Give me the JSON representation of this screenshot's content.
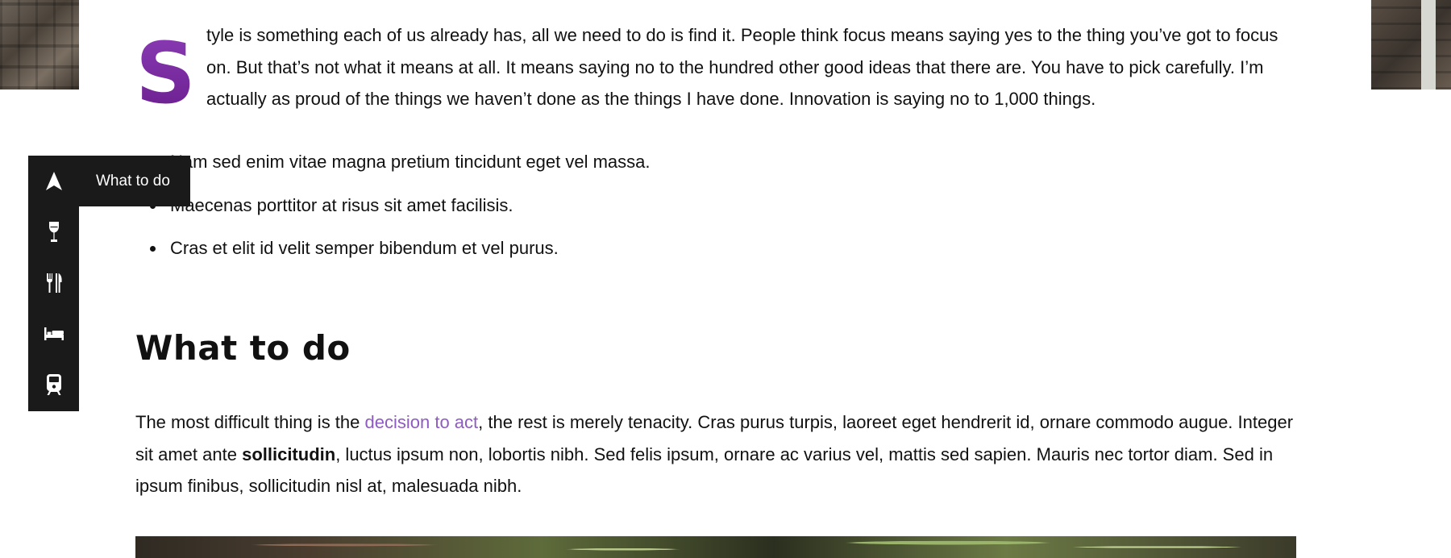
{
  "intro": {
    "drop_cap": "S",
    "text": "tyle is something each of us already has, all we need to do is find it. People think focus means saying yes to the thing you’ve got to focus on. But that’s not what it means at all. It means saying no to the hundred other good ideas that there are. You have to pick carefully. I’m actually as proud of the things we haven’t done as the things I have done. Innovation is saying no to 1,000 things."
  },
  "bullets": [
    "Nam sed enim vitae magna pretium tincidunt eget vel massa.",
    "Maecenas porttitor at risus sit amet facilisis.",
    "Cras et elit id velit semper bibendum et vel purus."
  ],
  "section": {
    "heading": "What to do",
    "para_before_link": "The most difficult thing is the ",
    "link_text": "decision to act",
    "para_after_link": ", the rest is merely tenacity. Cras purus turpis, laoreet eget hendrerit id, ornare commodo augue. Integer sit amet ante ",
    "bold_text": "sollicitudin",
    "para_end": ", luctus ipsum non, lobortis nibh. Sed felis ipsum, ornare ac varius vel, mattis sed sapien. Mauris nec tortor diam. Sed in ipsum finibus, sollicitudin nisl at, malesuada nibh."
  },
  "sidenav": {
    "tooltip": "What to do",
    "items": [
      {
        "icon": "navigation-arrow-icon"
      },
      {
        "icon": "wine-glass-icon"
      },
      {
        "icon": "fork-knife-icon"
      },
      {
        "icon": "bed-icon"
      },
      {
        "icon": "train-icon"
      }
    ]
  },
  "colors": {
    "accent": "#8e5cc0",
    "drop_cap": "#7b2aa0",
    "nav_bg": "#1a1a1a",
    "text": "#111111"
  }
}
